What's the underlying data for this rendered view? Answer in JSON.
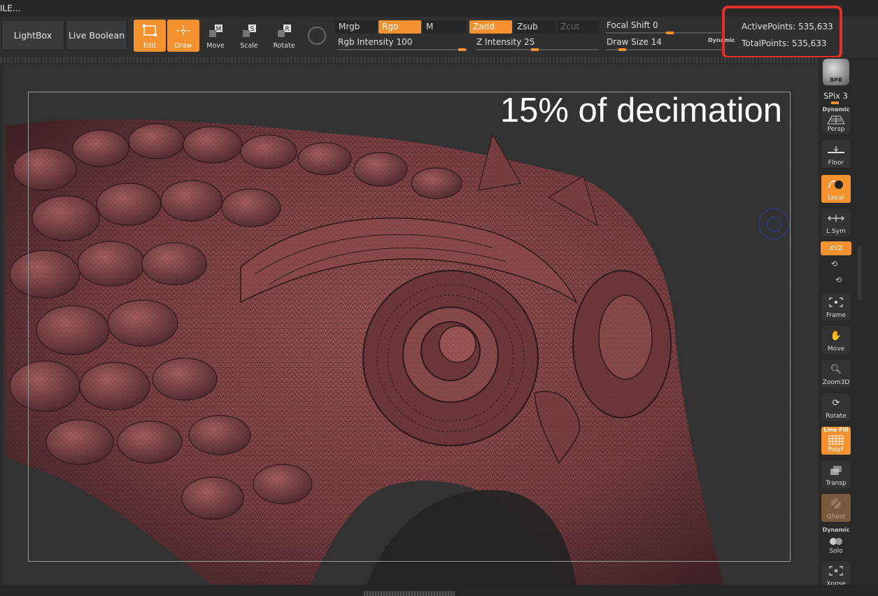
{
  "menu": {
    "text": "ILE..."
  },
  "toolbar": {
    "lightbox": "LightBox",
    "live_boolean": "Live Boolean",
    "tools": [
      {
        "label": "Edit",
        "active": true,
        "icon": "edit-icon"
      },
      {
        "label": "Draw",
        "active": true,
        "icon": "draw-icon"
      },
      {
        "label": "Move",
        "active": false,
        "icon": "move-icon"
      },
      {
        "label": "Scale",
        "active": false,
        "icon": "scale-icon"
      },
      {
        "label": "Rotate",
        "active": false,
        "icon": "rotate-icon"
      }
    ],
    "modes": {
      "mrgb": "Mrgb",
      "rgb": "Rgb",
      "m": "M",
      "zadd": "Zadd",
      "zsub": "Zsub",
      "zcut": "Zcut"
    },
    "rgb_intensity": {
      "label": "Rgb Intensity",
      "value": "100"
    },
    "z_intensity": {
      "label": "Z Intensity",
      "value": "25"
    },
    "focal_shift": {
      "label": "Focal Shift",
      "value": "0"
    },
    "draw_size": {
      "label": "Draw Size",
      "value": "14"
    },
    "dynamic": "Dynamic"
  },
  "stats": {
    "active_points": "ActivePoints: 535,633",
    "total_points": "TotalPoints: 535,633"
  },
  "canvas": {
    "caption": "15% of decimation"
  },
  "sidebar": {
    "bpr": "BPR",
    "spix": "SPix 3",
    "buttons": [
      {
        "top": "Dynamic",
        "label": "Persp",
        "active": false
      },
      {
        "top": "",
        "label": "Floor",
        "active": false
      },
      {
        "top": "",
        "label": "Local",
        "active": true
      },
      {
        "top": "",
        "label": "L.Sym",
        "active": false
      },
      {
        "top": "",
        "label": "XYZ",
        "active": true
      },
      {
        "top": "",
        "label": "Frame",
        "active": false
      },
      {
        "top": "",
        "label": "Move",
        "active": false
      },
      {
        "top": "",
        "label": "Zoom3D",
        "active": false
      },
      {
        "top": "",
        "label": "Rotate",
        "active": false
      },
      {
        "top": "Line Fill",
        "label": "PolyF",
        "active": true
      },
      {
        "top": "",
        "label": "Transp",
        "active": false
      },
      {
        "top": "",
        "label": "Ghost",
        "active": false
      },
      {
        "top": "Dynamic",
        "label": "Solo",
        "active": false
      },
      {
        "top": "",
        "label": "Xpose",
        "active": false
      }
    ]
  },
  "colors": {
    "accent": "#f5922f",
    "highlight_box": "#e0312b",
    "mesh": "#8a4a4c"
  }
}
